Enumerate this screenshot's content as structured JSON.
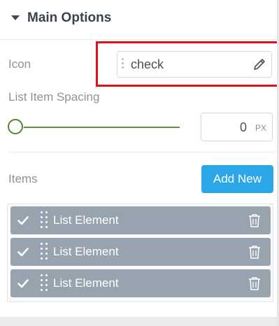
{
  "section": {
    "title": "Main Options"
  },
  "icon_control": {
    "label": "Icon",
    "value": "check"
  },
  "spacing_control": {
    "label": "List Item Spacing",
    "value": "0",
    "unit": "PX",
    "slider_level": 0
  },
  "items_control": {
    "label": "Items",
    "add_button": "Add New",
    "items": [
      {
        "label": "List Element"
      },
      {
        "label": "List Element"
      },
      {
        "label": "List Element"
      }
    ]
  },
  "colors": {
    "accent": "#2ba6e8",
    "slider": "#5e9438",
    "item_bg": "#97a3ae",
    "highlight": "#e2101a"
  }
}
